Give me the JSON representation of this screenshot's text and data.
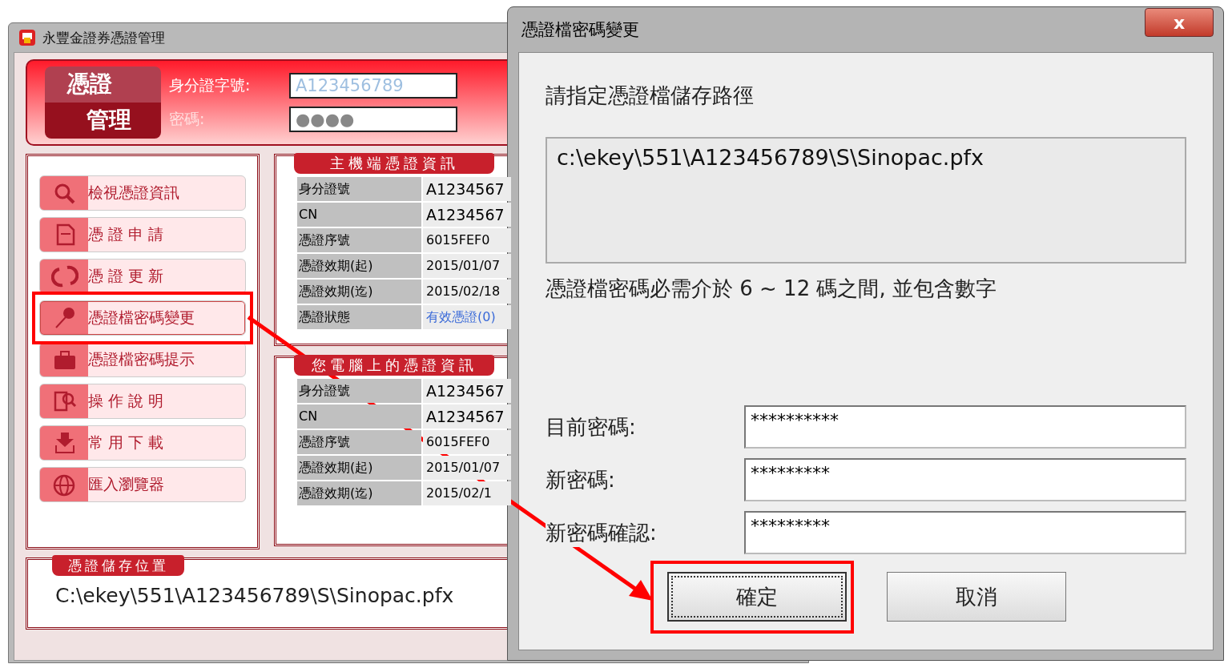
{
  "main_window": {
    "title": "永豐金證券憑證管理",
    "logo_top": "憑證",
    "logo_bottom": "管理",
    "id_label": "身分證字號:",
    "id_value": "A123456789",
    "password_label": "密碼:",
    "password_value": "●●●●"
  },
  "menu": [
    {
      "label": "檢視憑證資訊",
      "selected": false
    },
    {
      "label": "憑 證 申 請",
      "selected": false
    },
    {
      "label": "憑 證 更 新",
      "selected": false
    },
    {
      "label": "憑證檔密碼變更",
      "selected": true
    },
    {
      "label": "憑證檔密碼提示",
      "selected": false
    },
    {
      "label": "操 作 說 明",
      "selected": false
    },
    {
      "label": "常 用 下 載",
      "selected": false
    },
    {
      "label": "匯入瀏覽器",
      "selected": false
    }
  ],
  "host_info": {
    "title": "主機端憑證資訊",
    "rows": [
      {
        "label": "身分證號",
        "value": "A1234567",
        "kind": "big"
      },
      {
        "label": "CN",
        "value": "A1234567",
        "kind": "big"
      },
      {
        "label": "憑證序號",
        "value": "6015FEF0",
        "kind": "text"
      },
      {
        "label": "憑證效期(起)",
        "value": "2015/01/07",
        "kind": "text"
      },
      {
        "label": "憑證效期(迄)",
        "value": "2015/02/18",
        "kind": "text"
      },
      {
        "label": "憑證狀態",
        "value": "有效憑證(0)",
        "kind": "link"
      }
    ]
  },
  "local_info": {
    "title": "您電腦上的憑證資訊",
    "rows": [
      {
        "label": "身分證號",
        "value": "A1234567",
        "kind": "big"
      },
      {
        "label": "CN",
        "value": "A1234567",
        "kind": "big"
      },
      {
        "label": "憑證序號",
        "value": "6015FEF0",
        "kind": "text"
      },
      {
        "label": "憑證效期(起)",
        "value": "2015/01/07",
        "kind": "text"
      },
      {
        "label": "憑證效期(迄)",
        "value": "2015/02/1",
        "kind": "text"
      }
    ]
  },
  "storage": {
    "title": "憑證儲存位置",
    "path": "C:\\ekey\\551\\A123456789\\S\\Sinopac.pfx"
  },
  "dialog": {
    "title": "憑證檔密碼變更",
    "close": "x",
    "prompt": "請指定憑證檔儲存路徑",
    "path": "c:\\ekey\\551\\A123456789\\S\\Sinopac.pfx",
    "hint": "憑證檔密碼必需介於 6 ~ 12 碼之間, 並包含數字",
    "fields": [
      {
        "label": "目前密碼:",
        "value": "**********"
      },
      {
        "label": "新密碼:",
        "value": "*********"
      },
      {
        "label": "新密碼確認:",
        "value": "*********"
      }
    ],
    "buttons": [
      {
        "label": "確定",
        "selected": true
      },
      {
        "label": "取消",
        "selected": false
      }
    ]
  }
}
